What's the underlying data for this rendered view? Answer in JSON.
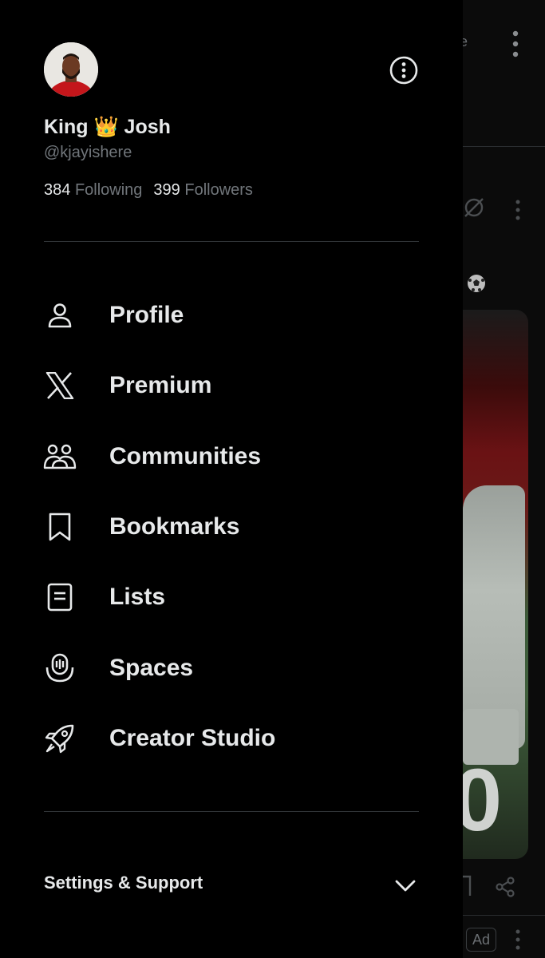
{
  "profile": {
    "display_name": "King 👑 Josh",
    "handle": "@kjayishere",
    "following_count": "384",
    "following_label": "Following",
    "followers_count": "399",
    "followers_label": "Followers"
  },
  "menu": {
    "items": [
      {
        "label": "Profile",
        "icon": "person-icon"
      },
      {
        "label": "Premium",
        "icon": "x-logo-icon"
      },
      {
        "label": "Communities",
        "icon": "communities-icon"
      },
      {
        "label": "Bookmarks",
        "icon": "bookmark-icon"
      },
      {
        "label": "Lists",
        "icon": "list-icon"
      },
      {
        "label": "Spaces",
        "icon": "spaces-icon"
      },
      {
        "label": "Creator Studio",
        "icon": "rocket-icon"
      }
    ]
  },
  "footer": {
    "settings_label": "Settings & Support"
  },
  "background": {
    "topbar_fragment": "le",
    "ad_badge": "Ad"
  },
  "colors": {
    "background": "#000000",
    "text_primary": "#e7e9ea",
    "text_secondary": "#71767b",
    "divider": "#2f3336"
  }
}
